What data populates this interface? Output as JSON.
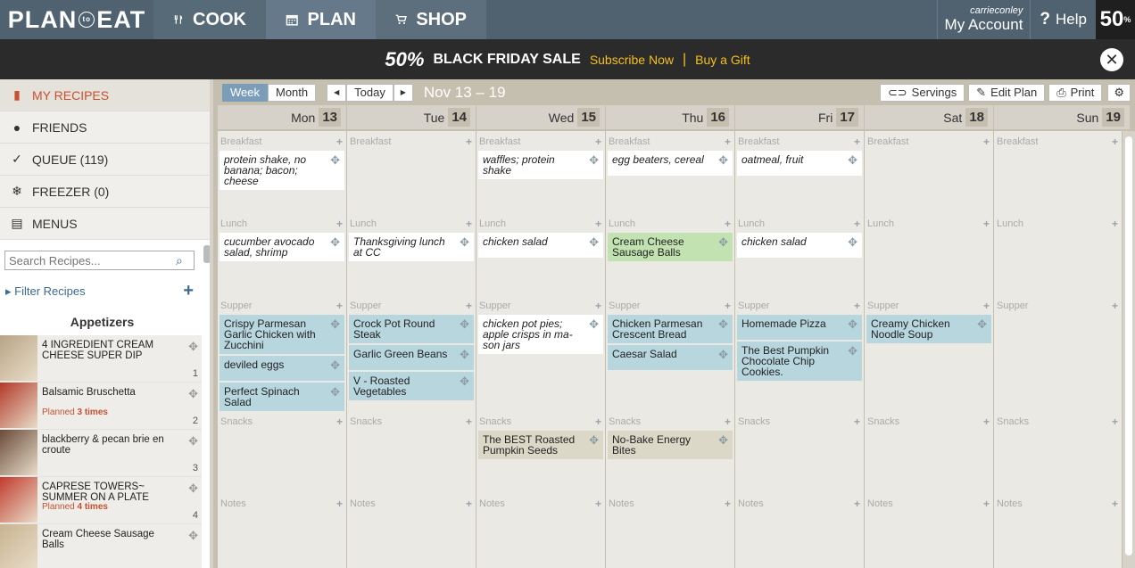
{
  "topbar": {
    "logo": {
      "left": "PLAN",
      "mid": "to",
      "right": "EAT"
    },
    "nav": [
      {
        "label": "COOK"
      },
      {
        "label": "PLAN"
      },
      {
        "label": "SHOP"
      }
    ],
    "user": "carrieconley",
    "account_label": "My Account",
    "help_label": "Help",
    "badge": {
      "pct": "50",
      "unit": "%",
      "off": "OFF"
    }
  },
  "banner": {
    "badge_text": "50%",
    "title": "BLACK FRIDAY SALE",
    "subscribe": "Subscribe Now",
    "separator": "|",
    "gift": "Buy a Gift"
  },
  "sidebar": {
    "nav": [
      {
        "label": "MY RECIPES",
        "icon": "book-icon"
      },
      {
        "label": "FRIENDS",
        "icon": "person-icon"
      },
      {
        "label": "QUEUE (119)",
        "icon": "check-icon"
      },
      {
        "label": "FREEZER (0)",
        "icon": "snowflake-icon"
      },
      {
        "label": "MENUS",
        "icon": "open-book-icon"
      }
    ],
    "search_placeholder": "Search Recipes...",
    "filter_label": "Filter Recipes",
    "category": "Appetizers",
    "recipes": [
      {
        "name": "4 INGREDIENT CREAM CHEESE SUPER DIP",
        "planned": "",
        "num": "1"
      },
      {
        "name": "Balsamic Bruschetta",
        "planned_prefix": "Planned ",
        "planned": "3 times",
        "num": "2"
      },
      {
        "name": "blackberry & pecan brie en croute",
        "planned": "",
        "num": "3"
      },
      {
        "name": "CAPRESE TOWERS~ SUMMER ON A PLATE",
        "planned_prefix": "Planned ",
        "planned": "4 times",
        "num": "4"
      },
      {
        "name": "Cream Cheese Sausage Balls",
        "planned": "",
        "num": ""
      }
    ]
  },
  "toolbar": {
    "week": "Week",
    "month": "Month",
    "today": "Today",
    "range": "Nov 13 – 19",
    "servings": "Servings",
    "edit_plan": "Edit Plan",
    "print": "Print"
  },
  "slot_labels": {
    "breakfast": "Breakfast",
    "lunch": "Lunch",
    "supper": "Supper",
    "snacks": "Snacks",
    "notes": "Notes"
  },
  "days": [
    {
      "name": "Mon",
      "num": "13",
      "breakfast": [
        {
          "text": "protein shake, no banana; bacon; cheese",
          "type": "note"
        }
      ],
      "lunch": [
        {
          "text": "cucumber avocado salad, shrimp",
          "type": "note"
        }
      ],
      "supper": [
        {
          "text": "Crispy Parmesan Garlic Chicken with Zucchini",
          "type": "rec"
        },
        {
          "text": "deviled eggs",
          "type": "rec"
        },
        {
          "text": "Perfect Spinach Salad",
          "type": "rec"
        }
      ],
      "snacks": []
    },
    {
      "name": "Tue",
      "num": "14",
      "breakfast": [],
      "lunch": [
        {
          "text": "Thanksgiving lunch at CC",
          "type": "note"
        }
      ],
      "supper": [
        {
          "text": "Crock Pot Round Steak",
          "type": "rec"
        },
        {
          "text": "Garlic Green Beans",
          "type": "rec"
        },
        {
          "text": "V - Roasted Vegetables",
          "type": "rec"
        }
      ],
      "snacks": []
    },
    {
      "name": "Wed",
      "num": "15",
      "breakfast": [
        {
          "text": "waffles; protein shake",
          "type": "note"
        }
      ],
      "lunch": [
        {
          "text": "chicken salad",
          "type": "note"
        }
      ],
      "supper": [
        {
          "text": "chicken pot pies; apple crisps in ma-son jars",
          "type": "note"
        }
      ],
      "snacks": [
        {
          "text": "The BEST Roasted Pumpkin Seeds",
          "type": "tan"
        }
      ]
    },
    {
      "name": "Thu",
      "num": "16",
      "breakfast": [
        {
          "text": "egg beaters, cereal",
          "type": "note"
        }
      ],
      "lunch": [
        {
          "text": "Cream Cheese Sausage Balls",
          "type": "green"
        }
      ],
      "supper": [
        {
          "text": "Chicken Parmesan Crescent Bread",
          "type": "rec"
        },
        {
          "text": "Caesar Salad",
          "type": "rec"
        }
      ],
      "snacks": [
        {
          "text": "No-Bake Energy Bites",
          "type": "tan"
        }
      ]
    },
    {
      "name": "Fri",
      "num": "17",
      "breakfast": [
        {
          "text": "oatmeal, fruit",
          "type": "note"
        }
      ],
      "lunch": [
        {
          "text": "chicken salad",
          "type": "note"
        }
      ],
      "supper": [
        {
          "text": "Homemade Pizza",
          "type": "rec"
        },
        {
          "text": "The Best Pumpkin Chocolate Chip Cookies.",
          "type": "rec"
        }
      ],
      "snacks": []
    },
    {
      "name": "Sat",
      "num": "18",
      "breakfast": [],
      "lunch": [],
      "supper": [
        {
          "text": "Creamy Chicken Noodle Soup",
          "type": "rec"
        }
      ],
      "snacks": []
    },
    {
      "name": "Sun",
      "num": "19",
      "breakfast": [],
      "lunch": [],
      "supper": [],
      "snacks": []
    }
  ]
}
